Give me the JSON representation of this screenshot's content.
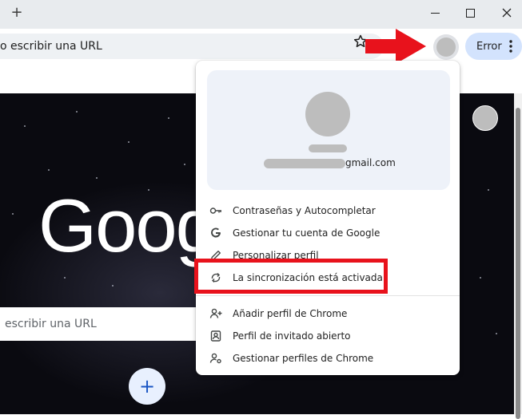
{
  "window": {
    "new_tab_symbol": "+",
    "minimize_icon": "minimize-icon",
    "maximize_icon": "maximize-icon",
    "close_icon": "close-icon"
  },
  "toolbar": {
    "omnibox_text": "o escribir una URL",
    "bookmark_icon": "star-icon",
    "error_label": "Error"
  },
  "ntp": {
    "logo_text": "Goog",
    "search_text": "escribir una URL",
    "add_shortcut_symbol": "+"
  },
  "profile_menu": {
    "email_suffix": "gmail.com",
    "items": [
      {
        "label": "Contraseñas y Autocompletar",
        "icon": "key-icon"
      },
      {
        "label": "Gestionar tu cuenta de Google",
        "icon": "google-g-icon"
      },
      {
        "label": "Personalizar perfil",
        "icon": "pencil-icon"
      },
      {
        "label": "La sincronización está activada",
        "icon": "sync-icon"
      },
      {
        "label": "Añadir perfil de Chrome",
        "icon": "add-person-icon"
      },
      {
        "label": "Perfil de invitado abierto",
        "icon": "guest-profile-icon"
      },
      {
        "label": "Gestionar perfiles de Chrome",
        "icon": "manage-profiles-icon"
      }
    ]
  },
  "annotations": {
    "arrow_color": "#e8121c",
    "highlight_color": "#e8121c"
  }
}
